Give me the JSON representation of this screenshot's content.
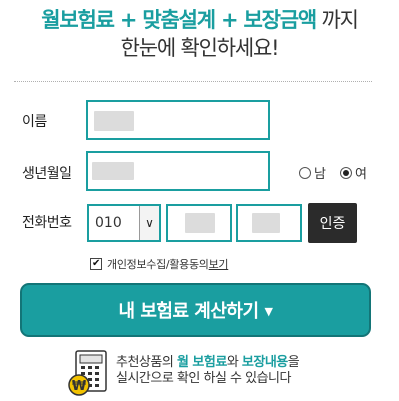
{
  "headline": {
    "part1": "월보험료",
    "plus1": " + ",
    "part2": "맞춤설계",
    "plus2": " + ",
    "part3": "보장금액",
    "tail": " 까지",
    "line2": "한눈에 확인하세요!"
  },
  "form": {
    "name_label": "이름",
    "birth_label": "생년월일",
    "phone_label": "전화번호",
    "gender": {
      "male": "남",
      "female": "여",
      "selected": "female"
    },
    "phone_prefix": "010",
    "select_arrow": "∨",
    "verify_label": "인증",
    "agree_checked": "✔",
    "agree_text": "개인정보수집/활용동의",
    "agree_link": "보기"
  },
  "cta": {
    "label": "내 보험료 계산하기",
    "arrow": "▼"
  },
  "footer": {
    "t1": "추천상품의 ",
    "h1": "월 보험료",
    "t2": "와 ",
    "h2": "보장내용",
    "t3": "을",
    "line2": "실시간으로 확인 하실 수 있습니다",
    "coin_symbol": "₩"
  },
  "colors": {
    "accent": "#1a9ea0",
    "dark": "#2b2b2b"
  }
}
